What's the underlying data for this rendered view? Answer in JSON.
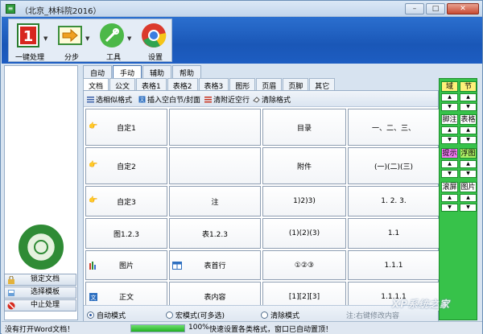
{
  "window": {
    "title": "（北京_林科院2016）",
    "btn_min": "–",
    "btn_max": "□",
    "btn_close": "✕"
  },
  "toolbar": {
    "one_key": {
      "label": "一键处理",
      "icon": "number-one-icon"
    },
    "step": {
      "label": "分步",
      "icon": "arrow-right-icon"
    },
    "tools": {
      "label": "工具",
      "icon": "tools-icon"
    },
    "settings": {
      "label": "设置",
      "icon": "chrome-icon"
    }
  },
  "mode_tabs": [
    "自动",
    "手动",
    "辅助",
    "帮助"
  ],
  "active_mode_tab": "手动",
  "sub_tabs": [
    "文档",
    "公文",
    "表格1",
    "表格2",
    "表格3",
    "图形",
    "页眉",
    "页脚",
    "其它"
  ],
  "actions": {
    "select_similar": "选相似格式",
    "insert_blank": "插入空白节/封面",
    "clear_blank_lines": "清附近空行",
    "clear_format": "清除格式"
  },
  "grid": [
    [
      "自定1",
      "",
      "目录",
      "一、二、三、"
    ],
    [
      "自定2",
      "",
      "附件",
      "(一)(二)(三)"
    ],
    [
      "自定3",
      "注",
      "1)2)3)",
      "1. 2. 3."
    ],
    [
      "图1.2.3",
      "表1.2.3",
      "(1)(2)(3)",
      "1.1"
    ],
    [
      "图片",
      "表首行",
      "①②③",
      "1.1.1"
    ],
    [
      "正文",
      "表内容",
      "[1][2][3]",
      "1.1.1.1"
    ]
  ],
  "modes": {
    "auto": "自动模式",
    "macro": "宏模式(可多选)",
    "clear": "清除模式",
    "hint": "注:右键修改内容",
    "selected": "自动模式"
  },
  "left_buttons": [
    "锁定文档",
    "选择模板",
    "中止处理"
  ],
  "right_panel": {
    "labels": [
      [
        "域",
        "节"
      ],
      [
        "脚注",
        "表格"
      ],
      [
        "提示",
        "浮图"
      ],
      [
        "滚屏",
        "图片"
      ]
    ],
    "up": "▲",
    "down": "▼"
  },
  "status": {
    "left": "没有打开Word文档！",
    "progress_percent": 100,
    "progress_label": "100%",
    "message": "快速设置各类格式，窗口已自动置顶！",
    "watermark": "XP系统之家"
  },
  "colors": {
    "accent": "#1a57b7",
    "right_panel": "#37c24a",
    "progress": "#22b022"
  }
}
